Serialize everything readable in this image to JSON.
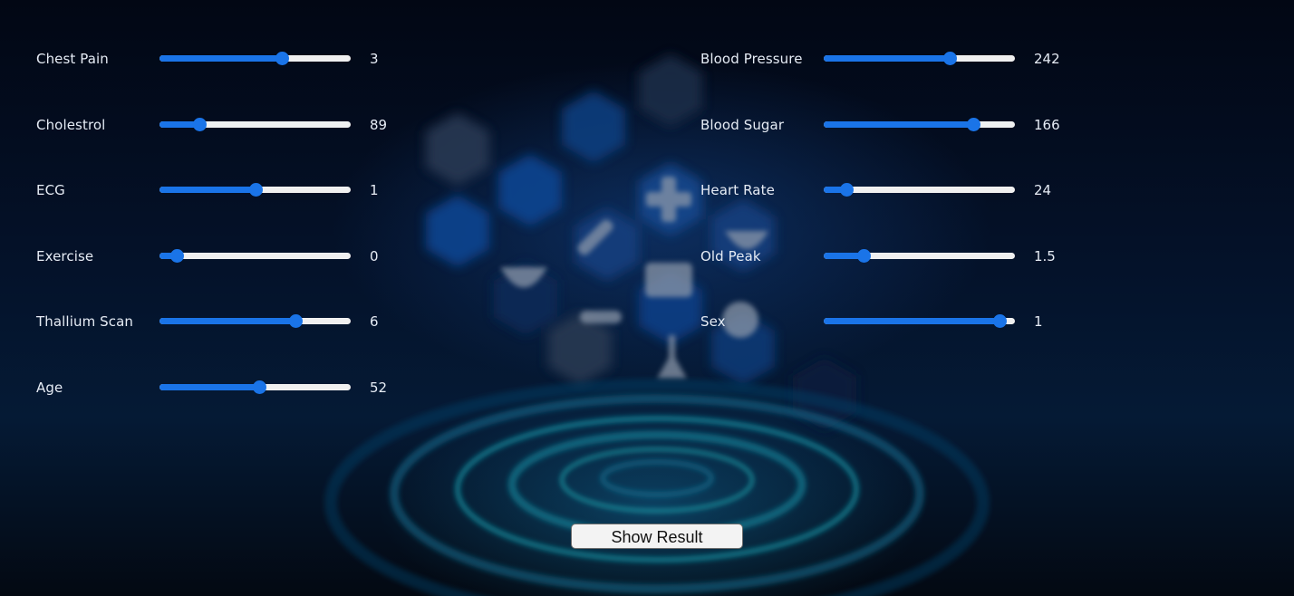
{
  "left_sliders": [
    {
      "label": "Chest Pain",
      "value": "3",
      "fraction": 0.64
    },
    {
      "label": "Cholestrol",
      "value": "89",
      "fraction": 0.21
    },
    {
      "label": "ECG",
      "value": "1",
      "fraction": 0.5
    },
    {
      "label": "Exercise",
      "value": "0",
      "fraction": 0.09
    },
    {
      "label": "Thallium Scan",
      "value": "6",
      "fraction": 0.71
    },
    {
      "label": "Age",
      "value": "52",
      "fraction": 0.52
    }
  ],
  "right_sliders": [
    {
      "label": "Blood Pressure",
      "value": "242",
      "fraction": 0.66
    },
    {
      "label": "Blood Sugar",
      "value": "166",
      "fraction": 0.78
    },
    {
      "label": "Heart Rate",
      "value": "24",
      "fraction": 0.12
    },
    {
      "label": "Old Peak",
      "value": "1.5",
      "fraction": 0.21
    },
    {
      "label": "Sex",
      "value": "1",
      "fraction": 0.92
    }
  ],
  "show_result_label": "Show Result",
  "colors": {
    "accent": "#1a74e8",
    "track": "#f0f0f0",
    "text": "#e6ecf5"
  }
}
